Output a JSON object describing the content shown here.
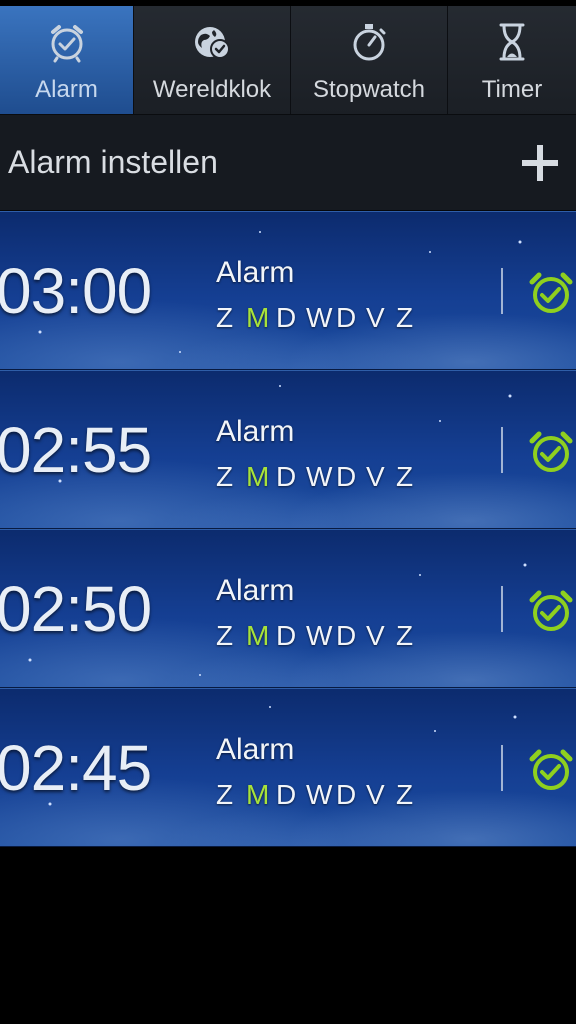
{
  "tabs": [
    {
      "label": "Alarm",
      "icon": "alarm-clock-icon",
      "active": true
    },
    {
      "label": "Wereldklok",
      "icon": "world-clock-icon",
      "active": false
    },
    {
      "label": "Stopwatch",
      "icon": "stopwatch-icon",
      "active": false
    },
    {
      "label": "Timer",
      "icon": "hourglass-icon",
      "active": false
    }
  ],
  "header": {
    "title": "Alarm instellen",
    "add_icon": "plus-icon"
  },
  "alarms": [
    {
      "time": "03:00",
      "name": "Alarm",
      "days": [
        "Z",
        "M",
        "D",
        "W",
        "D",
        "V",
        "Z"
      ],
      "active_day_index": 1,
      "enabled": true
    },
    {
      "time": "02:55",
      "name": "Alarm",
      "days": [
        "Z",
        "M",
        "D",
        "W",
        "D",
        "V",
        "Z"
      ],
      "active_day_index": 1,
      "enabled": true
    },
    {
      "time": "02:50",
      "name": "Alarm",
      "days": [
        "Z",
        "M",
        "D",
        "W",
        "D",
        "V",
        "Z"
      ],
      "active_day_index": 1,
      "enabled": true
    },
    {
      "time": "02:45",
      "name": "Alarm",
      "days": [
        "Z",
        "M",
        "D",
        "W",
        "D",
        "V",
        "Z"
      ],
      "active_day_index": 1,
      "enabled": true
    }
  ],
  "colors": {
    "accent": "#3a74bf",
    "active_day": "#a8e23a",
    "toggle_on": "#8fd01f"
  }
}
